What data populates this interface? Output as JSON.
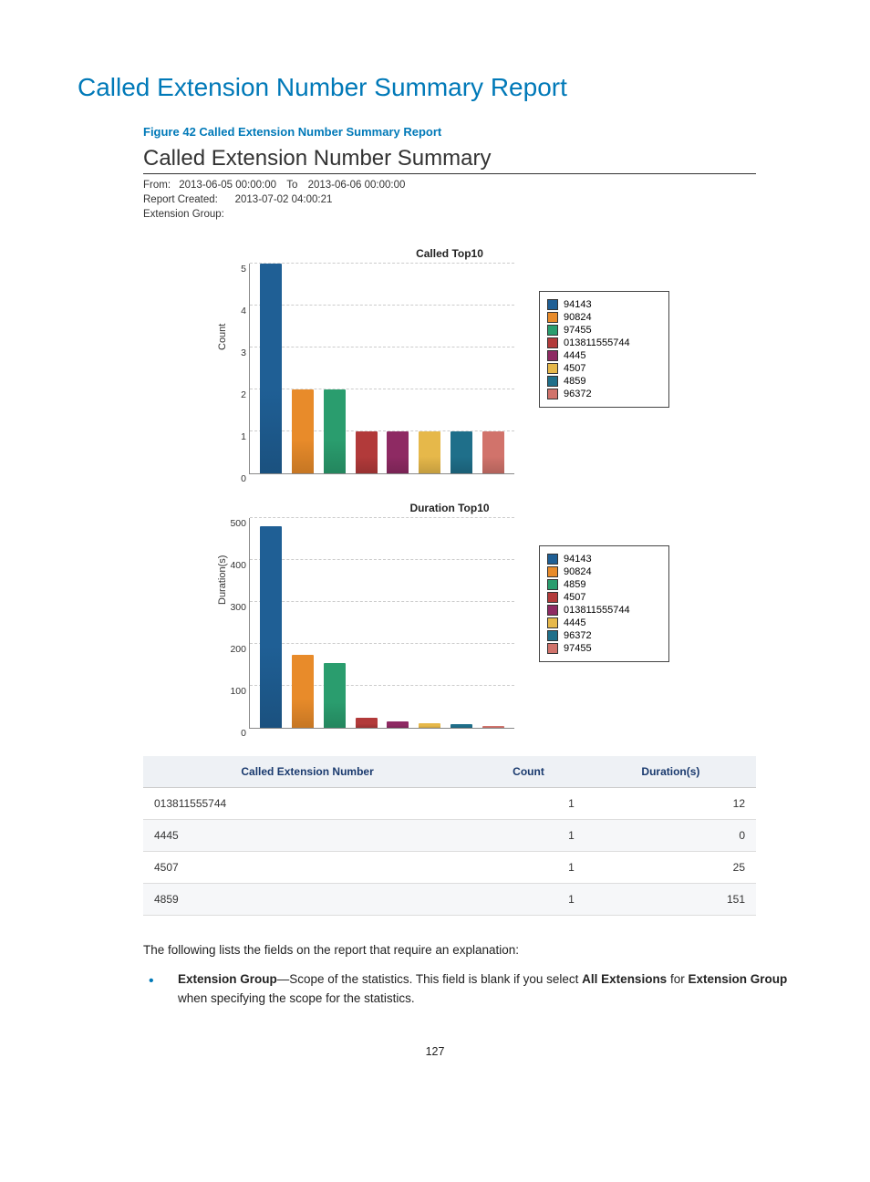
{
  "heading": "Called Extension Number Summary Report",
  "figure_caption": "Figure 42 Called Extension Number Summary Report",
  "report": {
    "title": "Called Extension Number Summary",
    "from_label": "From:",
    "from_value": "2013-06-05 00:00:00",
    "to_label": "To",
    "to_value": "2013-06-06 00:00:00",
    "created_label": "Report Created:",
    "created_value": "2013-07-02 04:00:21",
    "ext_group_label": "Extension Group:",
    "ext_group_value": ""
  },
  "chart_data": [
    {
      "type": "bar",
      "title": "Called Top10",
      "ylabel": "Count",
      "ylim": [
        0,
        5
      ],
      "yticks": [
        0,
        1,
        2,
        3,
        4,
        5
      ],
      "series": [
        {
          "name": "94143",
          "value": 5,
          "color": "#1f5f95"
        },
        {
          "name": "90824",
          "value": 2,
          "color": "#e88b2a"
        },
        {
          "name": "97455",
          "value": 2,
          "color": "#2a9d6e"
        },
        {
          "name": "013811555744",
          "value": 1,
          "color": "#b23a3a"
        },
        {
          "name": "4445",
          "value": 1,
          "color": "#8e2a63"
        },
        {
          "name": "4507",
          "value": 1,
          "color": "#e6b84a"
        },
        {
          "name": "4859",
          "value": 1,
          "color": "#1f6f8a"
        },
        {
          "name": "96372",
          "value": 1,
          "color": "#d1736b"
        }
      ]
    },
    {
      "type": "bar",
      "title": "Duration Top10",
      "ylabel": "Duration(s)",
      "ylim": [
        0,
        500
      ],
      "yticks": [
        0,
        100,
        200,
        300,
        400,
        500
      ],
      "series": [
        {
          "name": "94143",
          "value": 480,
          "color": "#1f5f95"
        },
        {
          "name": "90824",
          "value": 175,
          "color": "#e88b2a"
        },
        {
          "name": "4859",
          "value": 155,
          "color": "#2a9d6e"
        },
        {
          "name": "4507",
          "value": 25,
          "color": "#b23a3a"
        },
        {
          "name": "013811555744",
          "value": 15,
          "color": "#8e2a63"
        },
        {
          "name": "4445",
          "value": 10,
          "color": "#e6b84a"
        },
        {
          "name": "96372",
          "value": 8,
          "color": "#1f6f8a"
        },
        {
          "name": "97455",
          "value": 5,
          "color": "#d1736b"
        }
      ]
    }
  ],
  "table": {
    "headers": [
      "Called Extension Number",
      "Count",
      "Duration(s)"
    ],
    "rows": [
      [
        "013811555744",
        "1",
        "12"
      ],
      [
        "4445",
        "1",
        "0"
      ],
      [
        "4507",
        "1",
        "25"
      ],
      [
        "4859",
        "1",
        "151"
      ]
    ]
  },
  "body_text": "The following lists the fields on the report that require an explanation:",
  "bullet": {
    "term": "Extension Group",
    "dash": "—",
    "rest1": "Scope of the statistics. This field is blank if you select ",
    "bold1": "All Extensions",
    "rest2": " for ",
    "bold2": "Extension Group",
    "rest3": " when specifying the scope for the statistics."
  },
  "page_number": "127"
}
